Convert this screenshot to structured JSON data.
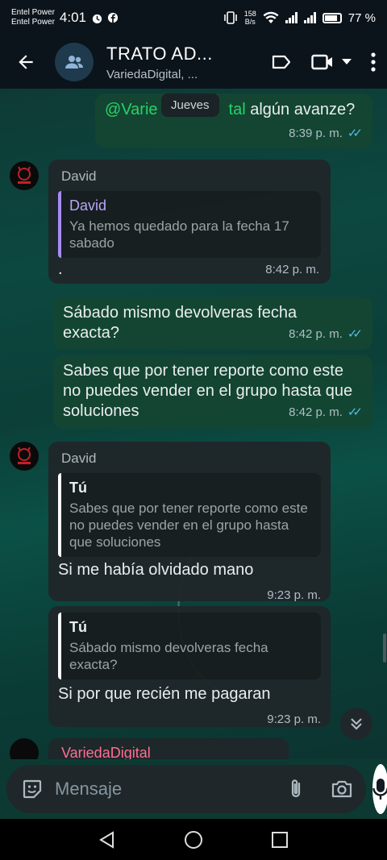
{
  "status": {
    "carrier1": "Entel Power",
    "carrier2": "Entel Power",
    "time": "4:01",
    "net_speed": "158",
    "net_unit": "B/s",
    "battery": "77 %"
  },
  "header": {
    "title": "TRATO AD...",
    "subtitle": "VariedaDigital, ..."
  },
  "chat": {
    "date_chip": "Jueves",
    "messages": [
      {
        "mention": "@Varie",
        "mention_tail": "tal",
        "text": " algún avanze?",
        "time": "8:39 p. m."
      },
      {
        "sender": "David",
        "quote_author": "David",
        "quote_text": "Ya hemos quedado para la fecha 17 sabado",
        "text": ".",
        "time": "8:42 p. m."
      },
      {
        "text": "Sábado mismo devolveras fecha exacta?",
        "time": "8:42 p. m."
      },
      {
        "text": "Sabes que por tener reporte como este no puedes vender en el grupo hasta que soluciones",
        "time": "8:42 p. m."
      },
      {
        "sender": "David",
        "quote_author": "Tú",
        "quote_text": "Sabes que por tener reporte como este no puedes vender en el grupo hasta que soluciones",
        "text": "Si me había olvidado mano",
        "time": "9:23 p. m."
      },
      {
        "quote_author": "Tú",
        "quote_text": "Sábado mismo devolveras fecha exacta?",
        "text": "Si por que recién me pagaran",
        "time": "9:23 p. m."
      },
      {
        "sender": "VariedaDigital"
      }
    ]
  },
  "composer": {
    "placeholder": "Mensaje"
  },
  "colors": {
    "outgoing_bubble": "#144632",
    "incoming_bubble": "#1f272a",
    "read_ticks": "#53bdeb",
    "mention": "#25d366"
  }
}
